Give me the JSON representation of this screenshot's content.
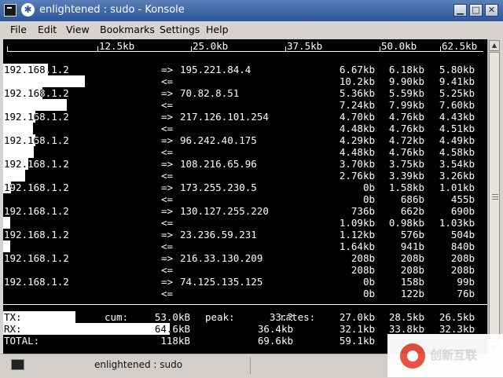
{
  "window": {
    "title": "enlightened : sudo - Konsole",
    "buttons": {
      "minimize": "▁",
      "maximize": "□",
      "close": "✕"
    }
  },
  "menu": [
    "File",
    "Edit",
    "View",
    "Bookmarks",
    "Settings",
    "Help"
  ],
  "scale": [
    "12.5kb",
    "25.0kb",
    "37.5kb",
    "50.0kb",
    "62.5kb"
  ],
  "rows": [
    {
      "host": "192.168.1.2",
      "out_dir": "=>",
      "remote": "195.221.84.4",
      "in_dir": "<=",
      "out_rates": [
        "6.67kb",
        "6.18kb",
        "5.80kb"
      ],
      "in_rates": [
        "10.2kb",
        "9.90kb",
        "9.41kb"
      ],
      "out_level": 0.5,
      "in_level": 1.0
    },
    {
      "host": "192.168.1.2",
      "out_dir": "=>",
      "remote": "70.82.8.51",
      "in_dir": "<=",
      "out_rates": [
        "5.36kb",
        "5.59kb",
        "5.25kb"
      ],
      "in_rates": [
        "7.24kb",
        "7.99kb",
        "7.60kb"
      ],
      "out_level": 0.44,
      "in_level": 0.78
    },
    {
      "host": "192.168.1.2",
      "out_dir": "=>",
      "remote": "217.126.101.254",
      "in_dir": "<=",
      "out_rates": [
        "4.70kb",
        "4.76kb",
        "4.43kb"
      ],
      "in_rates": [
        "4.48kb",
        "4.76kb",
        "4.51kb"
      ],
      "out_level": 0.36,
      "in_level": 0.36
    },
    {
      "host": "192.168.1.2",
      "out_dir": "=>",
      "remote": "96.242.40.175",
      "in_dir": "<=",
      "out_rates": [
        "4.29kb",
        "4.72kb",
        "4.49kb"
      ],
      "in_rates": [
        "4.48kb",
        "4.76kb",
        "4.58kb"
      ],
      "out_level": 0.36,
      "in_level": 0.37
    },
    {
      "host": "192.168.1.2",
      "out_dir": "=>",
      "remote": "108.216.65.96",
      "in_dir": "<=",
      "out_rates": [
        "3.70kb",
        "3.75kb",
        "3.54kb"
      ],
      "in_rates": [
        "2.76kb",
        "3.39kb",
        "3.26kb"
      ],
      "out_level": 0.28,
      "in_level": 0.26
    },
    {
      "host": "192.168.1.2",
      "out_dir": "=>",
      "remote": "173.255.230.5",
      "in_dir": "<=",
      "out_rates": [
        "0b",
        "1.58kb",
        "1.01kb"
      ],
      "in_rates": [
        "0b",
        "686b",
        "455b"
      ],
      "out_level": 0.08,
      "in_level": 0.0
    },
    {
      "host": "192.168.1.2",
      "out_dir": "=>",
      "remote": "130.127.255.220",
      "in_dir": "<=",
      "out_rates": [
        "736b",
        "662b",
        "690b"
      ],
      "in_rates": [
        "1.09kb",
        "0.98kb",
        "1.03kb"
      ],
      "out_level": 0.0,
      "in_level": 0.08
    },
    {
      "host": "192.168.1.2",
      "out_dir": "=>",
      "remote": "23.236.59.231",
      "in_dir": "<=",
      "out_rates": [
        "1.12kb",
        "576b",
        "504b"
      ],
      "in_rates": [
        "1.64kb",
        "941b",
        "840b"
      ],
      "out_level": 0.0,
      "in_level": 0.08
    },
    {
      "host": "192.168.1.2",
      "out_dir": "=>",
      "remote": "216.33.130.209",
      "in_dir": "<=",
      "out_rates": [
        "208b",
        "208b",
        "208b"
      ],
      "in_rates": [
        "208b",
        "208b",
        "208b"
      ],
      "out_level": 0.0,
      "in_level": 0.0
    },
    {
      "host": "192.168.1.2",
      "out_dir": "=>",
      "remote": "74.125.135.125",
      "in_dir": "<=",
      "out_rates": [
        "0b",
        "158b",
        "99b"
      ],
      "in_rates": [
        "0b",
        "122b",
        "76b"
      ],
      "out_level": 0.0,
      "in_level": 0.0
    }
  ],
  "totals": {
    "tx": {
      "label": "TX:",
      "cum_label": "cum:",
      "cum": "53.0kB",
      "peak_label": "peak:",
      "peak": "33.2",
      "rates_label": "rates:",
      "rates": [
        "27.0kb",
        "28.5kb",
        "26.5kb"
      ],
      "level": 0.3
    },
    "rx": {
      "label": "RX:",
      "cum": "64.6kB",
      "peak": "36.4kb",
      "rates": [
        "32.1kb",
        "33.8kb",
        "32.3kb"
      ],
      "level": 0.53
    },
    "total": {
      "label": "TOTAL:",
      "cum": "118kB",
      "peak": "69.6kb",
      "rates": [
        "59.1kb"
      ]
    }
  },
  "taskbar": {
    "label": "enlightened : sudo"
  },
  "watermark": {
    "text": "创新互联"
  }
}
